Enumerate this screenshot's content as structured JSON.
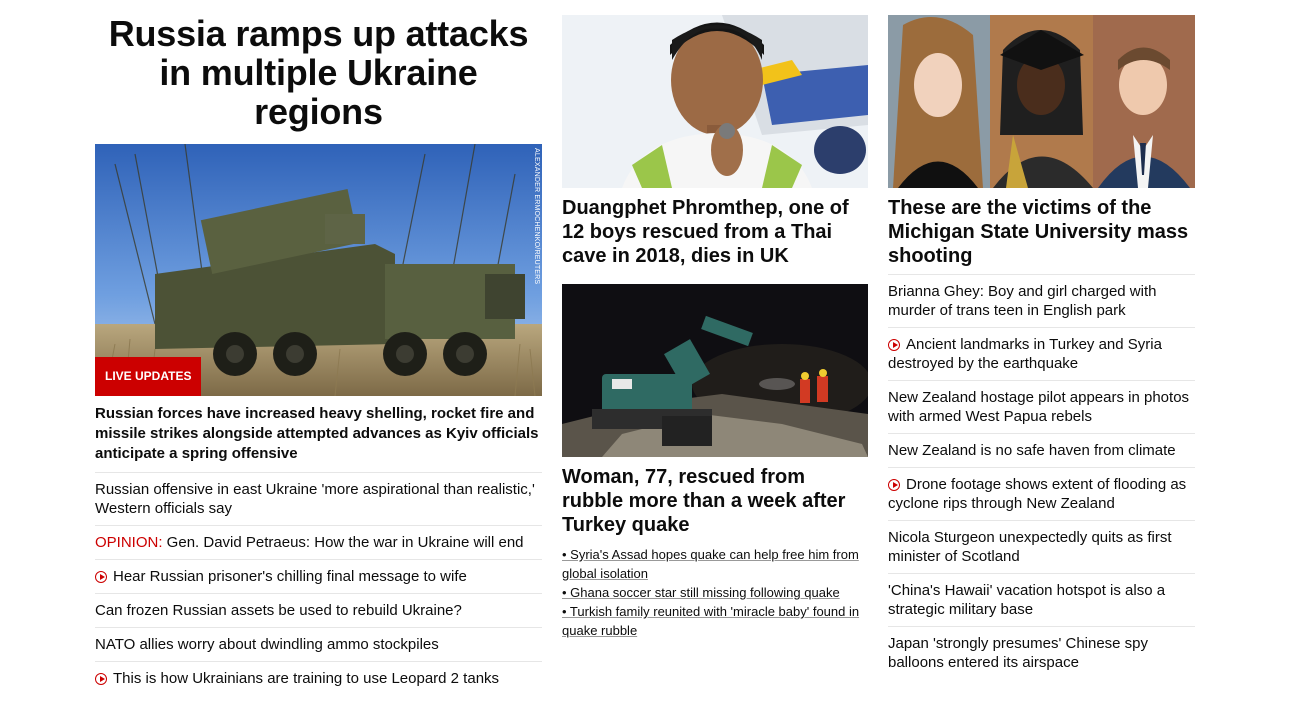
{
  "main_story": {
    "headline": "Russia ramps up attacks in multiple Ukraine regions",
    "image_credit": "ALEXANDER ERMOCHENKO/REUTERS",
    "badge": "LIVE UPDATES",
    "lead": "Russian forces have increased heavy shelling, rocket fire and missile strikes alongside attempted advances as Kyiv officials anticipate a spring offensive",
    "related": [
      {
        "text": "Russian offensive in east Ukraine 'more aspirational than realistic,' Western officials say"
      },
      {
        "prefix": "OPINION:",
        "text": " Gen. David Petraeus: How the war in Ukraine will end"
      },
      {
        "video": true,
        "text": "Hear Russian prisoner's chilling final message to wife"
      },
      {
        "text": "Can frozen Russian assets be used to rebuild Ukraine?"
      },
      {
        "text": "NATO allies worry about dwindling ammo stockpiles"
      },
      {
        "video": true,
        "text": "This is how Ukrainians are training to use Leopard 2 tanks"
      }
    ]
  },
  "middle": {
    "card1_title": "Duangphet Phromthep, one of 12 boys rescued from a Thai cave in 2018, dies in UK",
    "card2_title": "Woman, 77, rescued from rubble more than a week after Turkey quake",
    "bullets": [
      "• Syria's Assad hopes quake can help free him from global isolation",
      "• Ghana soccer star still missing following quake",
      "• Turkish family reunited with 'miracle baby' found in quake rubble"
    ]
  },
  "right": {
    "card_title": "These are the victims of the Michigan State University mass shooting",
    "items": [
      {
        "text": "Brianna Ghey: Boy and girl charged with murder of trans teen in English park"
      },
      {
        "video": true,
        "text": "Ancient landmarks in Turkey and Syria destroyed by the earthquake"
      },
      {
        "text": "New Zealand hostage pilot appears in photos with armed West Papua rebels"
      },
      {
        "text": "New Zealand is no safe haven from climate"
      },
      {
        "video": true,
        "text": "Drone footage shows extent of flooding as cyclone rips through New Zealand"
      },
      {
        "text": "Nicola Sturgeon unexpectedly quits as first minister of Scotland"
      },
      {
        "text": "'China's Hawaii' vacation hotspot is also a strategic military base"
      },
      {
        "text": "Japan 'strongly presumes' Chinese spy balloons entered its airspace"
      }
    ]
  },
  "colors": {
    "accent": "#cc0000",
    "divider": "#e6e6e6",
    "text": "#0c0c0c"
  }
}
